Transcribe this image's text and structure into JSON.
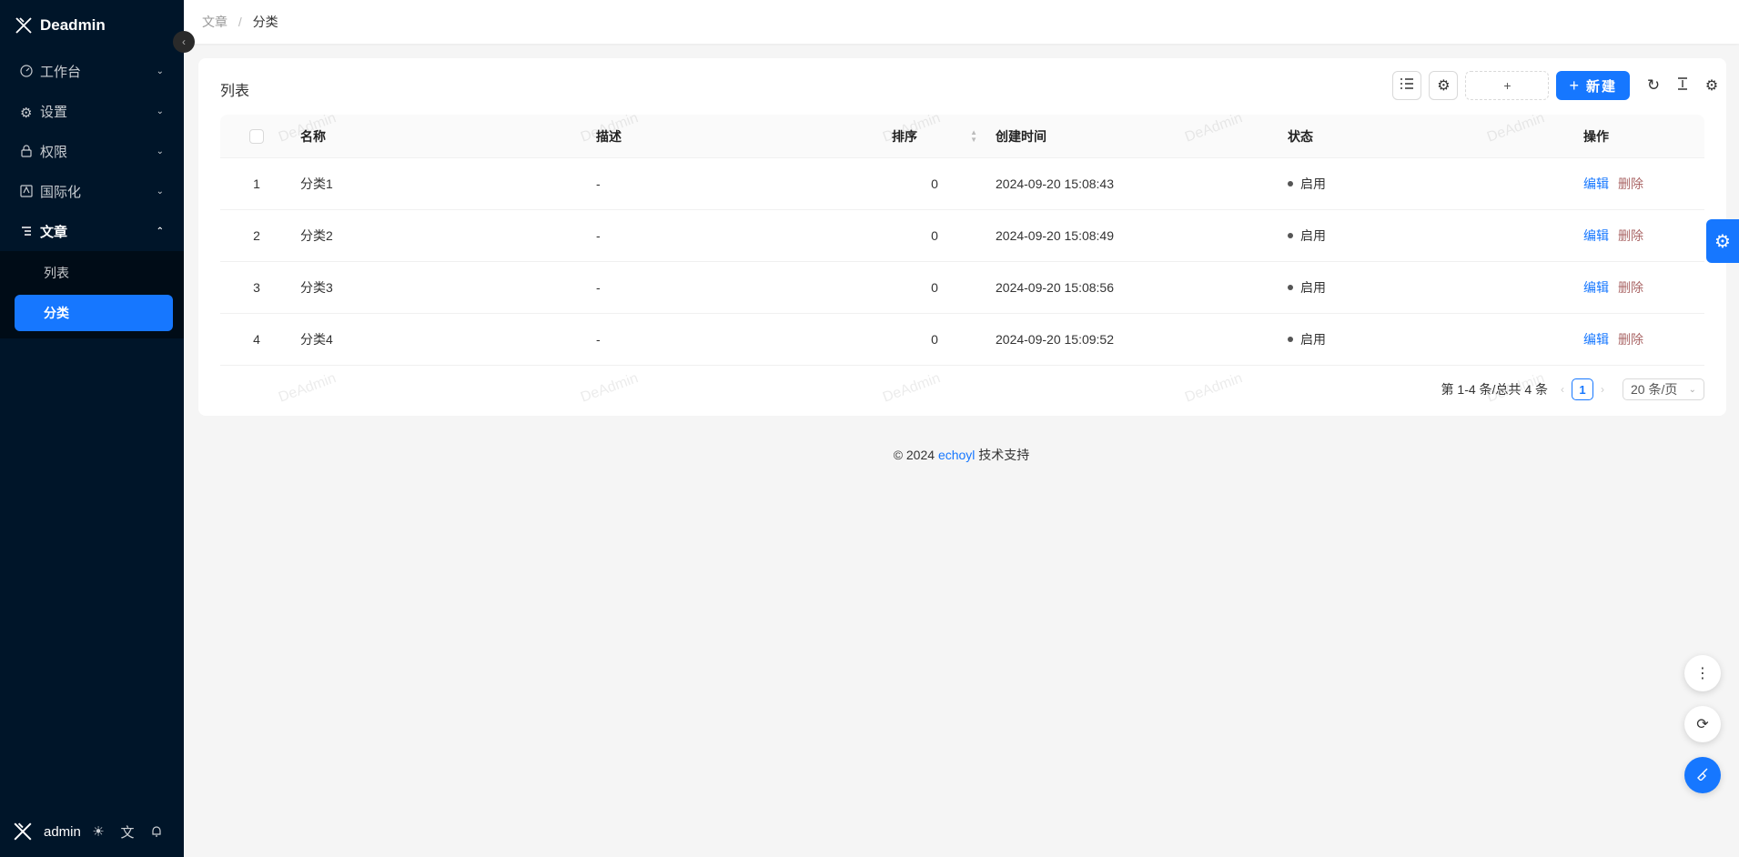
{
  "app": {
    "name": "Deadmin"
  },
  "sidebar": {
    "items": [
      {
        "label": "工作台",
        "icon": "dashboard-icon",
        "expanded": false
      },
      {
        "label": "设置",
        "icon": "gear-icon",
        "expanded": false
      },
      {
        "label": "权限",
        "icon": "lock-icon",
        "expanded": false
      },
      {
        "label": "国际化",
        "icon": "translate-icon",
        "expanded": false
      },
      {
        "label": "文章",
        "icon": "article-icon",
        "expanded": true
      }
    ],
    "subitems": [
      {
        "label": "列表",
        "active": false
      },
      {
        "label": "分类",
        "active": true
      }
    ],
    "footer": {
      "user": "admin"
    }
  },
  "breadcrumb": {
    "parent": "文章",
    "separator": "/",
    "current": "分类"
  },
  "card": {
    "title": "列表",
    "toolbar": {
      "dashed_label": "+",
      "new_label": "新建",
      "new_icon": "+"
    }
  },
  "table": {
    "headers": {
      "name": "名称",
      "desc": "描述",
      "sort": "排序",
      "time": "创建时间",
      "status": "状态",
      "op": "操作"
    },
    "rows": [
      {
        "index": "1",
        "name": "分类1",
        "desc": "-",
        "sort": "0",
        "time": "2024-09-20 15:08:43",
        "status": "启用",
        "edit": "编辑",
        "del": "删除"
      },
      {
        "index": "2",
        "name": "分类2",
        "desc": "-",
        "sort": "0",
        "time": "2024-09-20 15:08:49",
        "status": "启用",
        "edit": "编辑",
        "del": "删除"
      },
      {
        "index": "3",
        "name": "分类3",
        "desc": "-",
        "sort": "0",
        "time": "2024-09-20 15:08:56",
        "status": "启用",
        "edit": "编辑",
        "del": "删除"
      },
      {
        "index": "4",
        "name": "分类4",
        "desc": "-",
        "sort": "0",
        "time": "2024-09-20 15:09:52",
        "status": "启用",
        "edit": "编辑",
        "del": "删除"
      }
    ]
  },
  "pagination": {
    "summary": "第 1-4 条/总共 4 条",
    "current": "1",
    "page_size": "20 条/页"
  },
  "watermark": "DeAdmin",
  "footer": {
    "copyright": "© 2024",
    "link": "echoyl",
    "suffix": "技术支持"
  },
  "colors": {
    "sidebar_bg": "#001529",
    "primary": "#1677ff",
    "page_bg": "#f5f5f5"
  }
}
